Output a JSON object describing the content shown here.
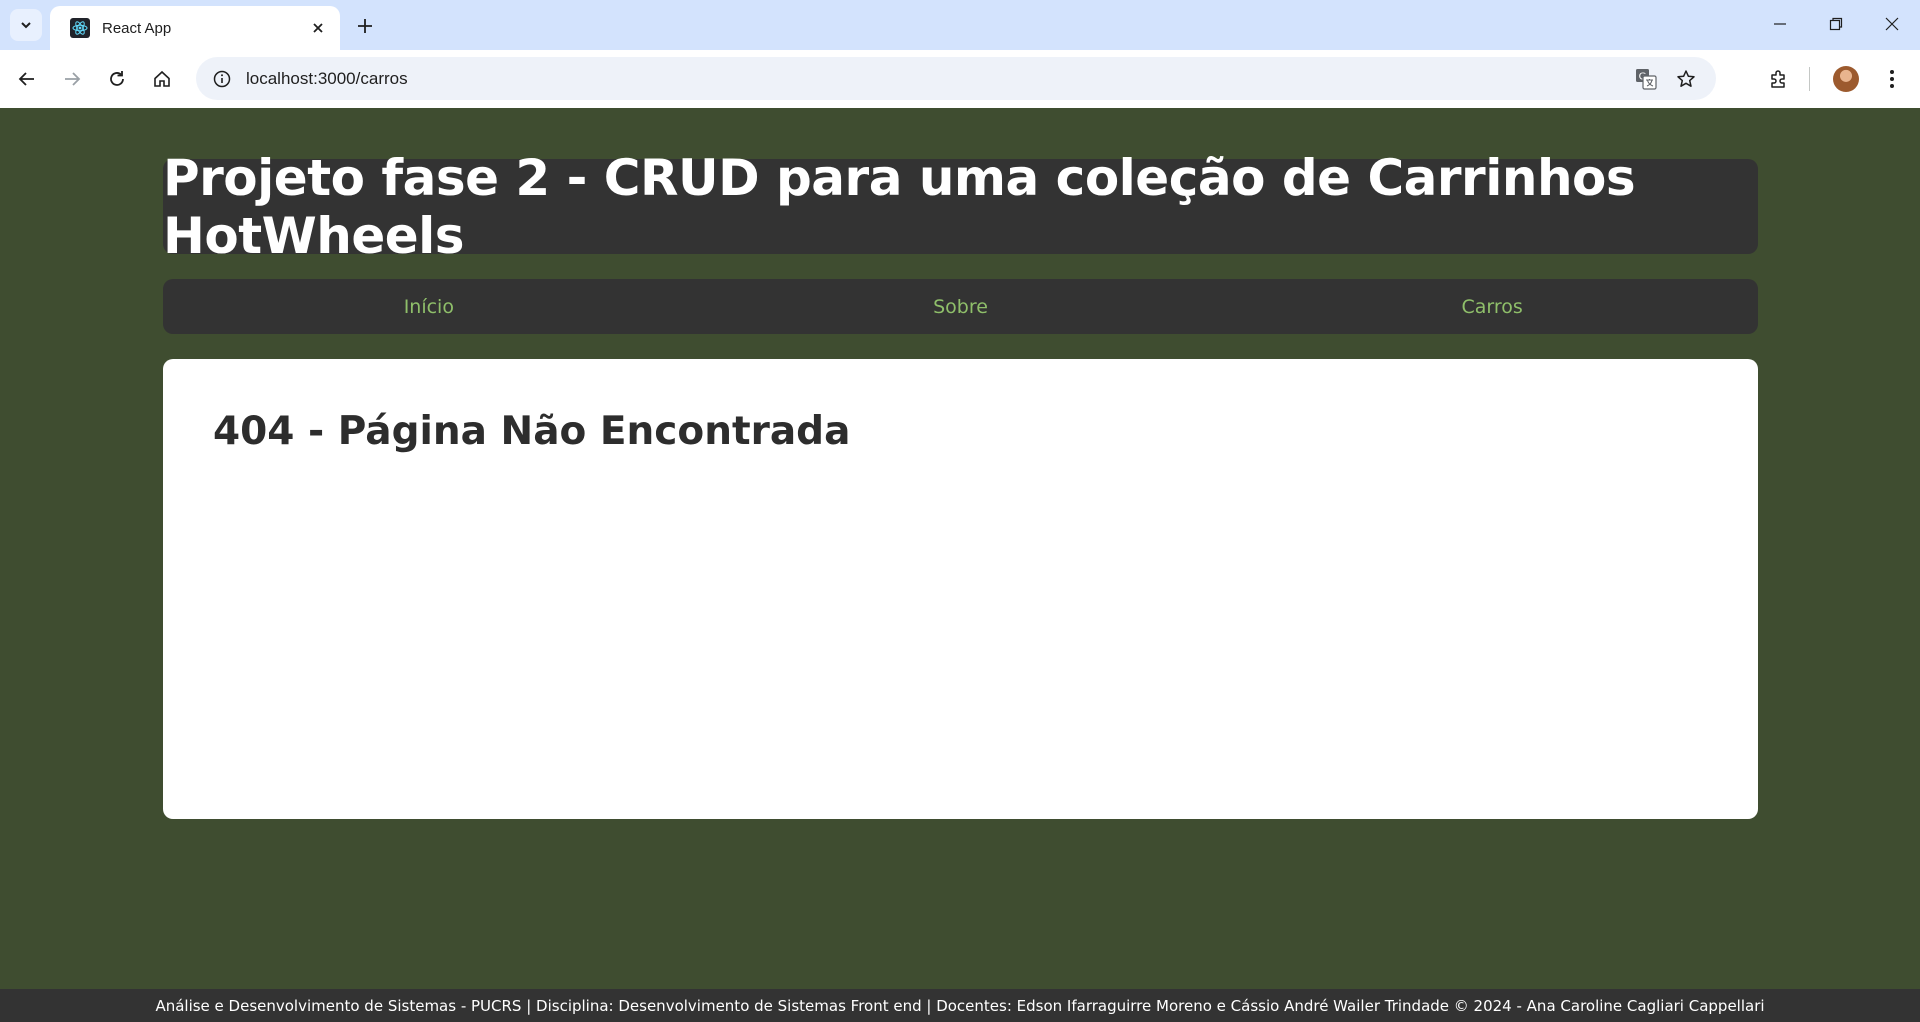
{
  "browser": {
    "tab_title": "React App",
    "url": "localhost:3000/carros",
    "icons": {
      "tab_search": "chevron-down-icon",
      "favicon": "react-icon",
      "tab_close": "close-icon",
      "new_tab": "plus-icon",
      "back": "arrow-left-icon",
      "forward": "arrow-right-icon",
      "reload": "reload-icon",
      "home": "home-icon",
      "site_info": "info-icon",
      "translate": "translate-icon",
      "bookmark": "star-icon",
      "extensions": "puzzle-icon",
      "menu": "kebab-menu-icon"
    }
  },
  "page": {
    "title": "Projeto fase 2 - CRUD para uma coleção de Carrinhos HotWheels",
    "nav": [
      {
        "label": "Início"
      },
      {
        "label": "Sobre"
      },
      {
        "label": "Carros"
      }
    ],
    "heading": "404 - Página Não Encontrada",
    "footer": "Análise e Desenvolvimento de Sistemas - PUCRS | Disciplina: Desenvolvimento de Sistemas Front end | Docentes: Edson Ifarraguirre Moreno e Cássio André Wailer Trindade © 2024 - Ana Caroline Cagliari Cappellari"
  },
  "colors": {
    "page_background": "#3f4d30",
    "panel_dark": "#333333",
    "nav_link": "#8fbf6a",
    "content_background": "#ffffff"
  }
}
